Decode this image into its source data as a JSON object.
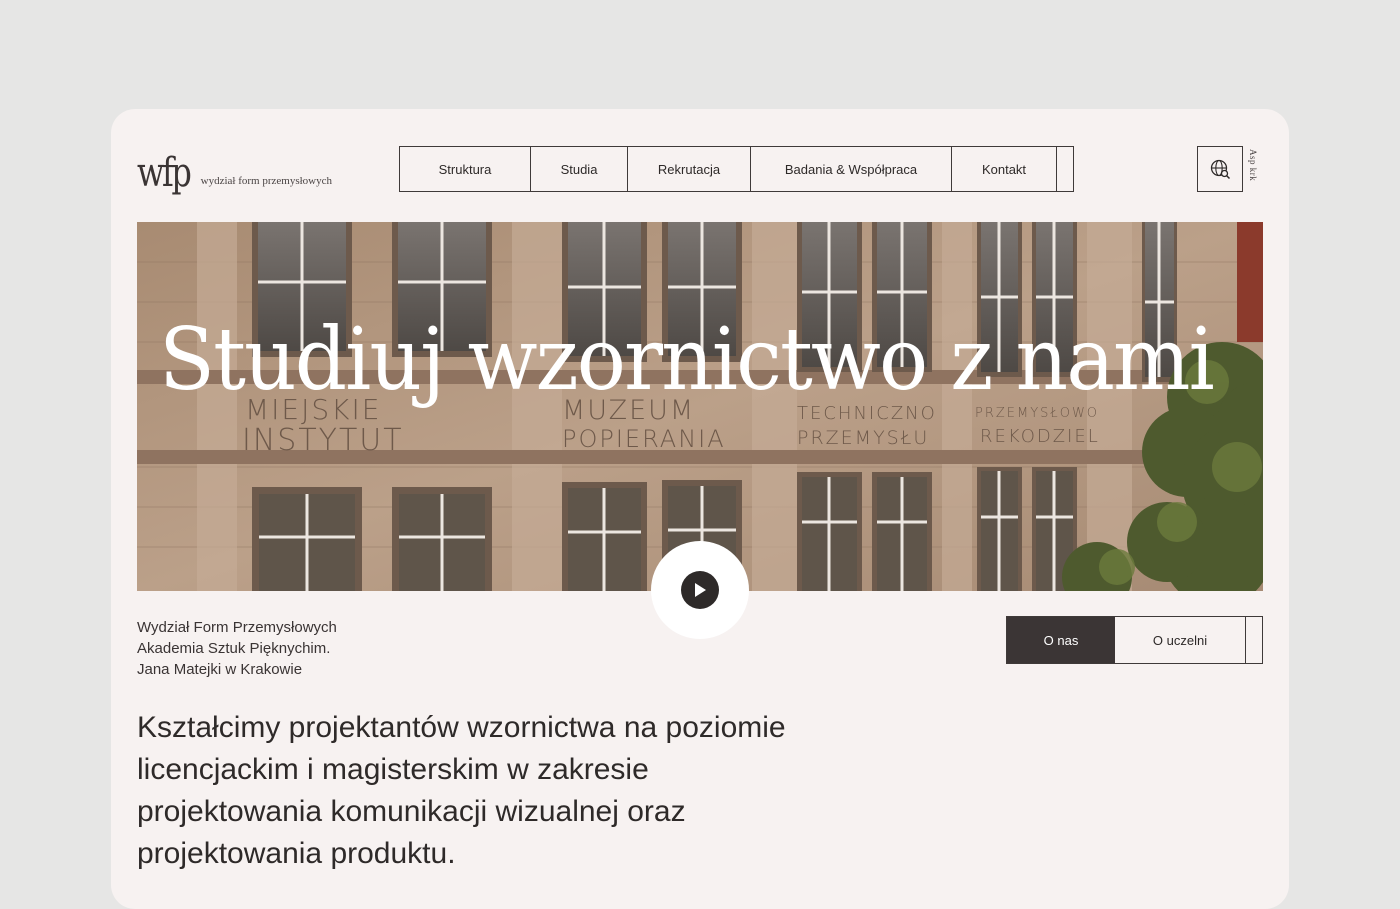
{
  "logo": {
    "mark": "wfp",
    "text": "wydział form przemysłowych"
  },
  "nav": {
    "items": [
      "Struktura",
      "Studia",
      "Rekrutacja",
      "Badania & Współpraca",
      "Kontakt"
    ]
  },
  "header": {
    "globe_icon": "globe-search-icon",
    "side_label": "Asp krk"
  },
  "hero": {
    "title": "Studiuj wzornictwo z nami",
    "facade_inscriptions": [
      "MIEJSKIE",
      "INSTYTUT",
      "MUZEUM",
      "POPIERANIA",
      "TECHNICZNO",
      "PRZEMYSŁU",
      "PRZEMYSŁOWO",
      "REKODZIEL"
    ],
    "play_icon": "play-icon"
  },
  "info": {
    "lines": [
      "Wydział Form Przemysłowych",
      "Akademia Sztuk Pięknychim.",
      "Jana Matejki w Krakowie"
    ]
  },
  "toggle": {
    "active": "O nas",
    "other": "O uczelni"
  },
  "lead": "Kształcimy projektantów wzornictwa na poziomie licencjackim i magisterskim w zakresie projektowania komunikacji wizualnej oraz projektowania produktu.",
  "colors": {
    "background": "#e6e6e5",
    "card": "#f7f2f1",
    "dark": "#3b3535",
    "stone": "#b79c82"
  }
}
